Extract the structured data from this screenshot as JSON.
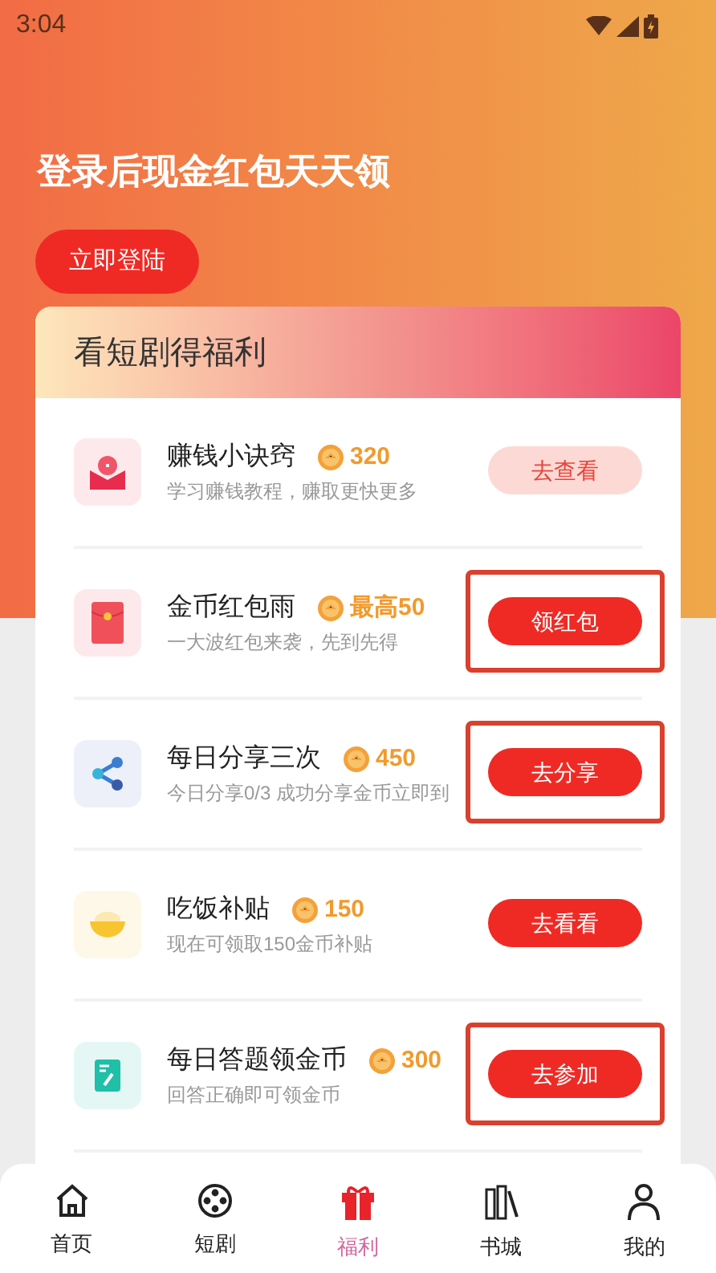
{
  "status_bar": {
    "time": "3:04"
  },
  "header": {
    "title": "登录后现金红包天天领",
    "login_button": "立即登陆"
  },
  "card": {
    "title": "看短剧得福利",
    "tasks": [
      {
        "title": "赚钱小诀窍",
        "reward": "320",
        "subtitle": "学习赚钱教程，赚取更快更多",
        "action": "去查看",
        "kind": "light",
        "highlighted": false
      },
      {
        "title": "金币红包雨",
        "reward": "最高50",
        "subtitle": "一大波红包来袭，先到先得",
        "action": "领红包",
        "kind": "solid",
        "highlighted": true
      },
      {
        "title": "每日分享三次",
        "reward": "450",
        "subtitle": "今日分享0/3 成功分享金币立即到",
        "action": "去分享",
        "kind": "solid",
        "highlighted": true
      },
      {
        "title": "吃饭补贴",
        "reward": "150",
        "subtitle": "现在可领取150金币补贴",
        "action": "去看看",
        "kind": "solid",
        "highlighted": false
      },
      {
        "title": "每日答题领金币",
        "reward": "300",
        "subtitle": "回答正确即可领金币",
        "action": "去参加",
        "kind": "solid",
        "highlighted": true
      }
    ]
  },
  "tab_bar": [
    {
      "label": "首页",
      "selected": false
    },
    {
      "label": "短剧",
      "selected": false
    },
    {
      "label": "福利",
      "selected": true
    },
    {
      "label": "书城",
      "selected": false
    },
    {
      "label": "我的",
      "selected": false
    }
  ]
}
